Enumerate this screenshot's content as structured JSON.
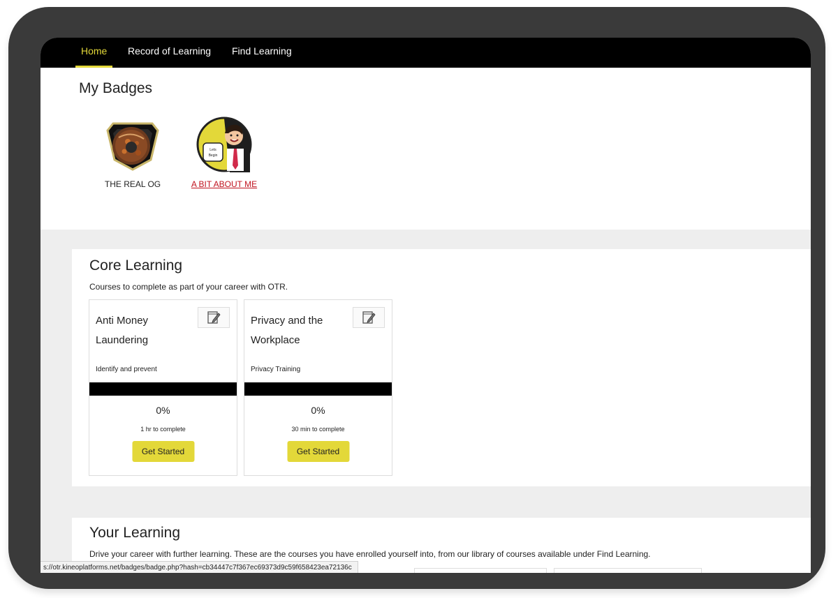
{
  "nav": {
    "items": [
      {
        "label": "Home",
        "active": true
      },
      {
        "label": "Record of Learning",
        "active": false
      },
      {
        "label": "Find Learning",
        "active": false
      }
    ]
  },
  "badges": {
    "title": "My Badges",
    "items": [
      {
        "label": "THE REAL OG",
        "icon": "donut-shield-badge-icon",
        "link": false
      },
      {
        "label": "A BIT ABOUT ME",
        "icon": "businessman-lets-begin-badge-icon",
        "badge_text_line1": "Lets",
        "badge_text_line2": "Begin",
        "link": true
      }
    ]
  },
  "core_learning": {
    "title": "Core Learning",
    "subtitle": "Courses to complete as part of your career with OTR.",
    "cards": [
      {
        "title": "Anti Money Laundering",
        "description": "Identify and prevent",
        "progress_pct": 0,
        "progress_label": "0%",
        "duration": "1 hr to complete",
        "button": "Get Started",
        "icon": "edit-notepad-icon"
      },
      {
        "title": "Privacy and the Workplace",
        "description": "Privacy Training",
        "progress_pct": 0,
        "progress_label": "0%",
        "duration": "30 min to complete",
        "button": "Get Started",
        "icon": "edit-notepad-icon"
      }
    ]
  },
  "your_learning": {
    "title": "Your Learning",
    "subtitle": "Drive your career with further learning. These are the courses you have enrolled yourself into, from our library of courses available under Find Learning."
  },
  "status_bar": {
    "url": "s://otr.kineoplatforms.net/badges/badge.php?hash=cb34447c7f367ec69373d9c59f658423ea72136c"
  },
  "colors": {
    "accent": "#e3d839",
    "nav_bg": "#000000",
    "link": "#c0121e",
    "frame": "#3a3a3a"
  }
}
